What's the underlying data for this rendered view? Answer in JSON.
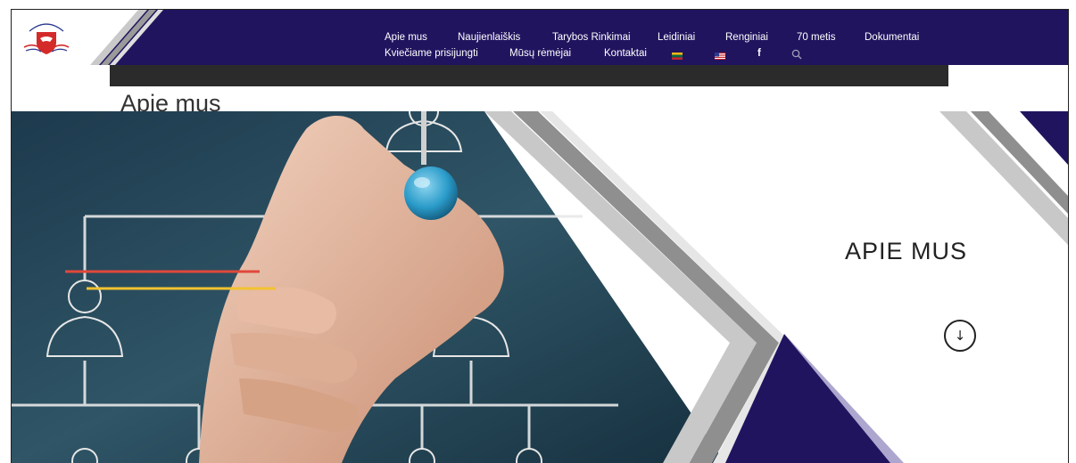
{
  "header": {
    "nav_row1": [
      "Apie mus",
      "Naujienlaiškis",
      "Tarybos Rinkimai",
      "Leidiniai",
      "Renginiai",
      "70 metis",
      "Dokumentai"
    ],
    "nav_row2": [
      "Kviečiame prisijungti",
      "Mūsų rėmėjai",
      "Kontaktai"
    ],
    "icons": [
      "lithuania-flag-icon",
      "usa-flag-icon",
      "facebook-icon",
      "search-icon"
    ],
    "facebook_glyph": "f",
    "colors": {
      "header_bg": "#21145f",
      "dark_bar": "#2b2b2b",
      "accent_red": "#e0483b",
      "accent_yellow": "#f2c230"
    }
  },
  "page": {
    "title": "Apie mus"
  },
  "hero": {
    "heading": "APIE MUS",
    "scroll_icon": "arrow-down-icon",
    "scroll_glyph": "↓"
  }
}
